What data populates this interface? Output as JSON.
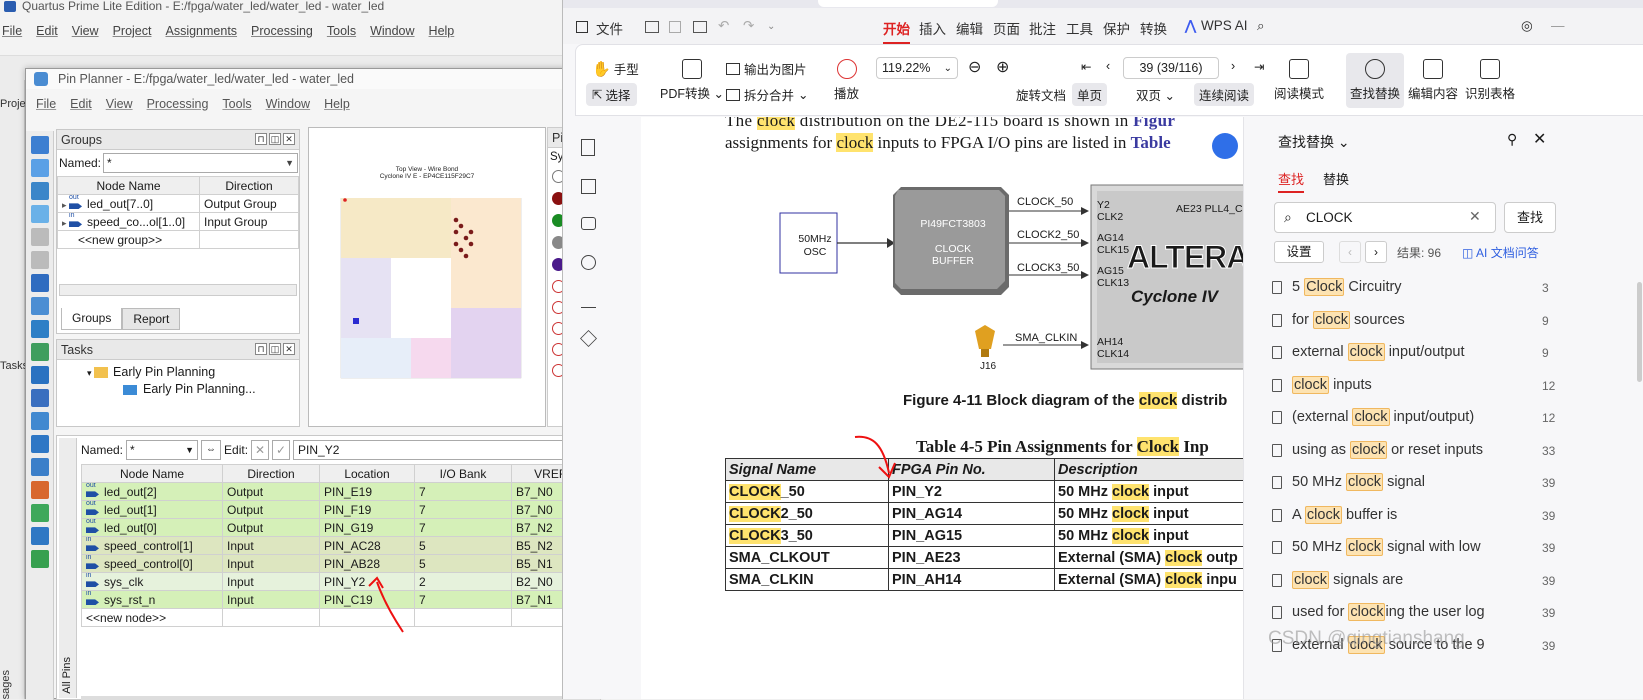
{
  "quartus": {
    "title": "Quartus Prime Lite Edition - E:/fpga/water_led/water_led - water_led",
    "menu": [
      "File",
      "Edit",
      "View",
      "Project",
      "Assignments",
      "Processing",
      "Tools",
      "Window",
      "Help"
    ],
    "left_labels": [
      "Projec",
      "Tasks",
      "sages"
    ]
  },
  "pin_planner": {
    "title": "Pin Planner - E:/fpga/water_led/water_led - water_led",
    "menu": [
      "File",
      "Edit",
      "View",
      "Processing",
      "Tools",
      "Window",
      "Help"
    ],
    "groups": {
      "title": "Groups",
      "named_label": "Named:",
      "named_value": "*",
      "headers": [
        "Node Name",
        "Direction"
      ],
      "rows": [
        {
          "tag": "out",
          "name": "led_out[7..0]",
          "dir": "Output Group"
        },
        {
          "tag": "in",
          "name": "speed_co...ol[1..0]",
          "dir": "Input Group"
        },
        {
          "tag": "",
          "name": "<<new group>>",
          "dir": ""
        }
      ],
      "tabs": [
        "Groups",
        "Report"
      ]
    },
    "tasks": {
      "title": "Tasks",
      "items": [
        "Early Pin Planning",
        "Early Pin Planning..."
      ]
    },
    "chip": {
      "line1": "Top View - Wire Bond",
      "line2": "Cyclone IV E - EP4CE115F29C7"
    },
    "pins_panel_label": "Pin",
    "pins_sym_label": "Sym",
    "filter": {
      "named_label": "Named:",
      "named_value": "*",
      "edit_label": "Edit:",
      "edit_value": "PIN_Y2"
    },
    "all_pins_label": "All Pins",
    "pin_headers": [
      "Node Name",
      "Direction",
      "Location",
      "I/O Bank",
      "VREF G"
    ],
    "pins": [
      {
        "tag": "out",
        "name": "led_out[2]",
        "dir": "Output",
        "loc": "PIN_E19",
        "bank": "7",
        "vref": "B7_N0",
        "kind": "out"
      },
      {
        "tag": "out",
        "name": "led_out[1]",
        "dir": "Output",
        "loc": "PIN_F19",
        "bank": "7",
        "vref": "B7_N0",
        "kind": "out"
      },
      {
        "tag": "out",
        "name": "led_out[0]",
        "dir": "Output",
        "loc": "PIN_G19",
        "bank": "7",
        "vref": "B7_N2",
        "kind": "out"
      },
      {
        "tag": "in",
        "name": "speed_control[1]",
        "dir": "Input",
        "loc": "PIN_AC28",
        "bank": "5",
        "vref": "B5_N2",
        "kind": "in"
      },
      {
        "tag": "in",
        "name": "speed_control[0]",
        "dir": "Input",
        "loc": "PIN_AB28",
        "bank": "5",
        "vref": "B5_N1",
        "kind": "in"
      },
      {
        "tag": "in",
        "name": "sys_clk",
        "dir": "Input",
        "loc": "PIN_Y2",
        "bank": "2",
        "vref": "B2_N0",
        "kind": "sel"
      },
      {
        "tag": "in",
        "name": "sys_rst_n",
        "dir": "Input",
        "loc": "PIN_C19",
        "bank": "7",
        "vref": "B7_N1",
        "kind": "out"
      }
    ],
    "new_node": "<<new node>>"
  },
  "wps": {
    "menu": [
      "文件",
      "开始",
      "插入",
      "编辑",
      "页面",
      "批注",
      "工具",
      "保护",
      "转换"
    ],
    "active_tab": "开始",
    "ai_label": "WPS AI",
    "ribbon": {
      "hand": "手型",
      "select": "选择",
      "pdf_convert": "PDF转换",
      "export_img": "输出为图片",
      "split_merge": "拆分合并",
      "play": "播放",
      "zoom": "119.22%",
      "page": "39 (39/116)",
      "rotate": "旋转文档",
      "single": "单页",
      "double": "双页",
      "continuous": "连续阅读",
      "read_mode": "阅读模式",
      "find_replace": "查找替换",
      "edit_content": "编辑内容",
      "table_ocr": "识别表格"
    },
    "doc": {
      "line1_a": "The ",
      "line1_hl": "clock",
      "line1_b": " distribution on the DE2-115 board is shown in ",
      "line1_link": "Figur",
      "line2_a": "assignments for ",
      "line2_hl": "clock",
      "line2_b": " inputs to FPGA I/O pins are listed in ",
      "line2_link": "Table",
      "diagram": {
        "osc": [
          "50MHz",
          "OSC"
        ],
        "buffer_name": "PI49FCT3803",
        "buffer_label": [
          "CLOCK",
          "BUFFER"
        ],
        "sigs": [
          "CLOCK_50",
          "CLOCK2_50",
          "CLOCK3_50",
          "SMA_CLKIN"
        ],
        "pins": [
          "Y2",
          "CLK2",
          "AG14",
          "CLK15",
          "AG15",
          "CLK13",
          "AH14",
          "CLK14"
        ],
        "chip_text": "AE23 PLL4_C",
        "brand": "ALTERA",
        "family": "Cyclone IV",
        "conn": "J16"
      },
      "fig_caption_a": "Figure 4-11    Block diagram of the ",
      "fig_caption_hl": "clock",
      "fig_caption_b": " distrib",
      "table_caption_a": "Table 4-5    Pin Assignments for ",
      "table_caption_hl": "Clock",
      "table_caption_b": " Inp",
      "table_headers": [
        "Signal Name",
        "FPGA Pin No.",
        "Description"
      ],
      "table_rows": [
        {
          "sig_hl": "CLOCK",
          "sig_rest": "_50",
          "pin": "PIN_Y2",
          "desc_a": "50 MHz ",
          "desc_hl": "clock",
          "desc_b": " input"
        },
        {
          "sig_hl": "CLOCK",
          "sig_rest": "2_50",
          "pin": "PIN_AG14",
          "desc_a": "50 MHz ",
          "desc_hl": "clock",
          "desc_b": " input"
        },
        {
          "sig_hl": "CLOCK",
          "sig_rest": "3_50",
          "pin": "PIN_AG15",
          "desc_a": "50 MHz ",
          "desc_hl": "clock",
          "desc_b": " input"
        },
        {
          "sig_hl": "",
          "sig_rest": "SMA_CLKOUT",
          "pin": "PIN_AE23",
          "desc_a": "External (SMA) ",
          "desc_hl": "clock",
          "desc_b": " outp"
        },
        {
          "sig_hl": "",
          "sig_rest": "SMA_CLKIN",
          "pin": "PIN_AH14",
          "desc_a": "External (SMA) ",
          "desc_hl": "clock",
          "desc_b": " inpu"
        }
      ]
    },
    "find": {
      "title": "查找替换",
      "tab_find": "查找",
      "tab_replace": "替换",
      "query": "CLOCK",
      "find_btn": "查找",
      "settings": "设置",
      "results": "结果: 96",
      "ai_btn": "AI 文档问答",
      "items": [
        {
          "pre": "5 ",
          "hl": "Clock",
          "post": " Circuitry",
          "n": "3"
        },
        {
          "pre": "for ",
          "hl": "clock",
          "post": " sources",
          "n": "9"
        },
        {
          "pre": "external ",
          "hl": "clock",
          "post": " input/output",
          "n": "9"
        },
        {
          "pre": "",
          "hl": "clock",
          "post": " inputs",
          "n": "12"
        },
        {
          "pre": "(external ",
          "hl": "clock",
          "post": " input/output)",
          "n": "12"
        },
        {
          "pre": "using as ",
          "hl": "clock",
          "post": " or reset inputs",
          "n": "33"
        },
        {
          "pre": "50 MHz ",
          "hl": "clock",
          "post": " signal",
          "n": "39"
        },
        {
          "pre": "A ",
          "hl": "clock",
          "post": " buffer is",
          "n": "39"
        },
        {
          "pre": "50 MHz ",
          "hl": "clock",
          "post": " signal with low",
          "n": "39"
        },
        {
          "pre": "",
          "hl": "clock",
          "post": " signals are",
          "n": "39"
        },
        {
          "pre": "used for ",
          "hl": "clock",
          "post": "ing the user log",
          "n": "39"
        },
        {
          "pre": "external ",
          "hl": "clock",
          "post": " source to the 9",
          "n": "39"
        }
      ]
    },
    "watermark": "CSDN @qingtianshang"
  }
}
